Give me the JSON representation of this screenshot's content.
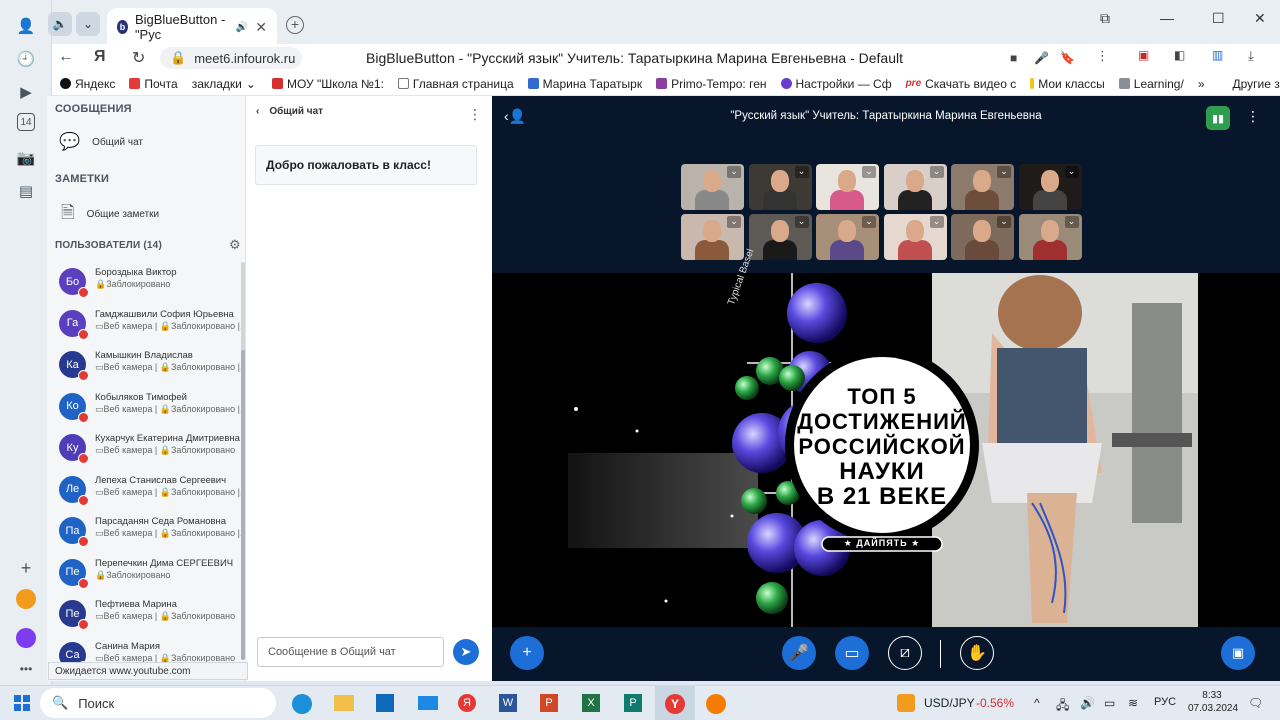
{
  "browser": {
    "tab_title": "BigBlueButton - \"Рус",
    "url": "meet6.infourok.ru",
    "page_title": "BigBlueButton - \"Русский язык\" Учитель: Таратыркина Марина Евгеньевна - Default",
    "bookmarks": [
      "Яндекс",
      "Почта",
      "закладки",
      "МОУ \"Школа №1:",
      "Главная страница",
      "Марина Таратырк",
      "Primo-Tempo: ген",
      "Настройки — Сф",
      "Скачать видео с",
      "Мои классы",
      "Learning/"
    ],
    "other_bookmarks": "Другие закладки",
    "sidebar_badge": "14"
  },
  "sidebar": {
    "messages_title": "СООБЩЕНИЯ",
    "public_chat": "Общий чат",
    "notes_title": "ЗАМЕТКИ",
    "shared_notes": "Общие заметки",
    "users_title": "ПОЛЬЗОВАТЕЛИ (14)",
    "users": [
      {
        "initials": "Бо",
        "name": "Бороздыка Виктор",
        "status": "🔒Заблокировано",
        "color": "#5b3fbf"
      },
      {
        "initials": "Га",
        "name": "Гамджашвили София Юрьевна",
        "status": "▭Веб камера | 🔒Заблокировано |...",
        "color": "#5b3fbf"
      },
      {
        "initials": "Ка",
        "name": "Камышкин Владислав",
        "status": "▭Веб камера | 🔒Заблокировано |...",
        "color": "#283a8f"
      },
      {
        "initials": "Ко",
        "name": "Кобыляков Тимофей",
        "status": "▭Веб камера | 🔒Заблокировано |...",
        "color": "#1f63c4"
      },
      {
        "initials": "Ку",
        "name": "Кухарчук Екатерина Дмитриевна",
        "status": "▭Веб камера | 🔒Заблокировано",
        "color": "#4f3db8"
      },
      {
        "initials": "Ле",
        "name": "Лепеха Станислав Сергеевич",
        "status": "▭Веб камера | 🔒Заблокировано |...",
        "color": "#1f63c4"
      },
      {
        "initials": "Па",
        "name": "Парсаданян Седа Романовна",
        "status": "▭Веб камера | 🔒Заблокировано |...",
        "color": "#1f63c4"
      },
      {
        "initials": "Пе",
        "name": "Перепечкин Дима СЕРГЕЕВИЧ",
        "status": "🔒Заблокировано",
        "color": "#1f63c4"
      },
      {
        "initials": "Пе",
        "name": "Пефтиева Марина",
        "status": "▭Веб камера | 🔒Заблокировано",
        "color": "#283a8f"
      },
      {
        "initials": "Са",
        "name": "Санина Мария",
        "status": "▭Веб камера | 🔒Заблокировано",
        "color": "#283a8f"
      }
    ]
  },
  "chat": {
    "header": "Общий чат",
    "welcome": "Добро пожаловать в класс!",
    "placeholder": "Сообщение в Общий чат"
  },
  "meeting": {
    "title": "\"Русский язык\" Учитель: Таратыркина Марина Евгеньевна",
    "video_text": [
      "ТОП 5",
      "ДОСТИЖЕНИЙ",
      "РОССИЙСКОЙ",
      "НАУКИ",
      "В 21 ВЕКЕ"
    ],
    "video_brand": "★ ДАЙПЯТЬ ★",
    "video_sign": "Typical Basel"
  },
  "status_tooltip": "Ожидается www.youtube.com",
  "taskbar": {
    "search": "Поиск",
    "ticker_label": "USD/JPY",
    "ticker_value": "-0.56%",
    "lang": "РУС",
    "time": "8:33",
    "date": "07.03.2024"
  }
}
